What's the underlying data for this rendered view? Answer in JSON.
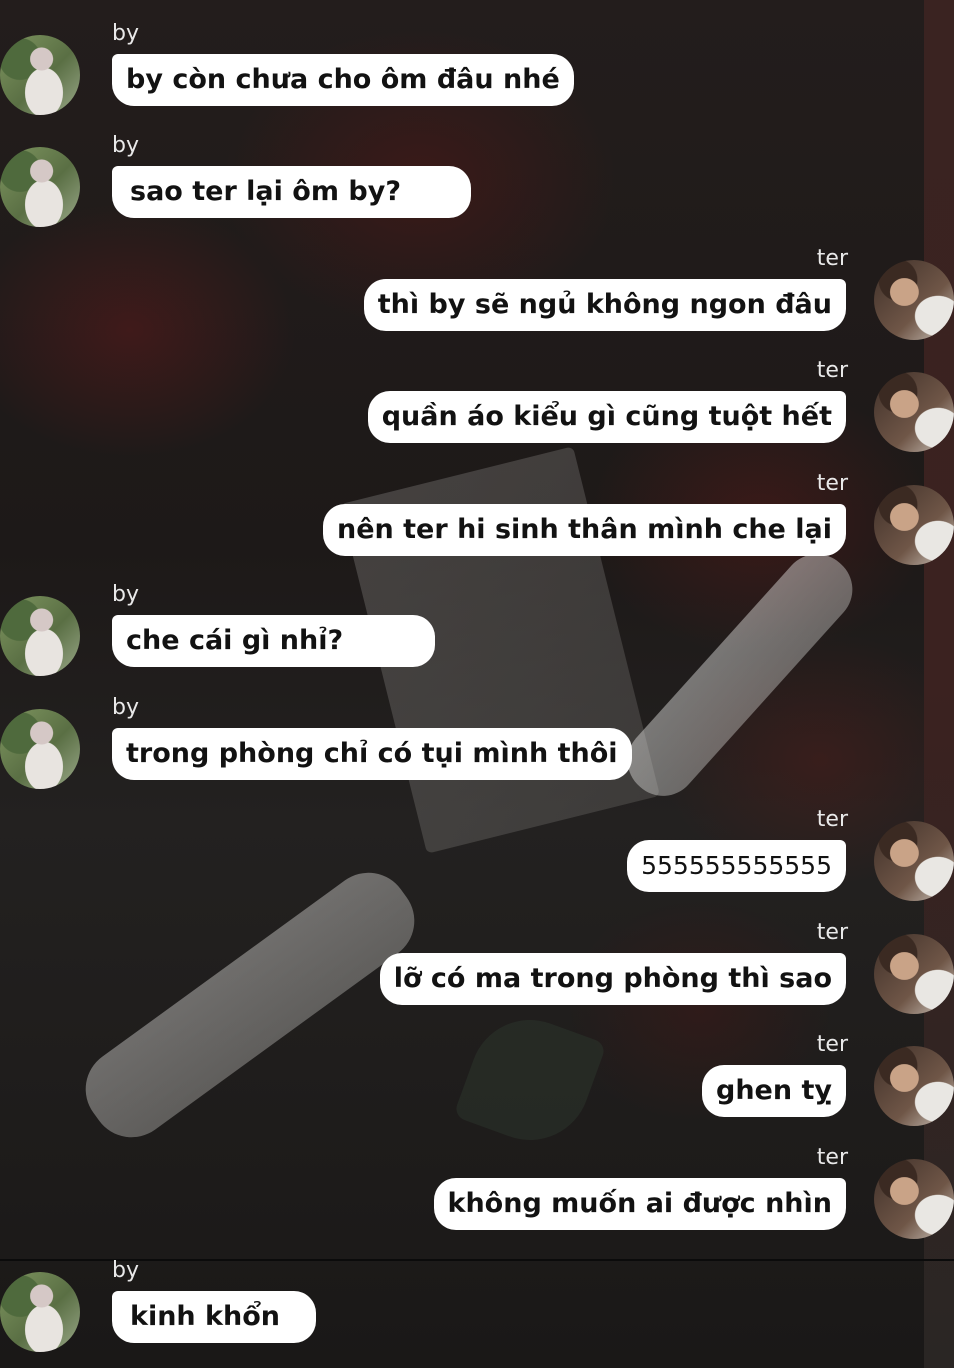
{
  "chat": {
    "messages": [
      {
        "sender": "by",
        "side": "left",
        "text": "by còn chưa cho ôm đâu nhé"
      },
      {
        "sender": "by",
        "side": "left",
        "text": "sao ter lại ôm by?"
      },
      {
        "sender": "ter",
        "side": "right",
        "text": "thì by sẽ ngủ không ngon đâu"
      },
      {
        "sender": "ter",
        "side": "right",
        "text": "quần áo kiểu gì cũng tuột hết"
      },
      {
        "sender": "ter",
        "side": "right",
        "text": "nên ter hi sinh thân mình che lại"
      },
      {
        "sender": "by",
        "side": "left",
        "text": "che cái gì nhỉ?"
      },
      {
        "sender": "by",
        "side": "left",
        "text": "trong phòng chỉ có tụi mình thôi"
      },
      {
        "sender": "ter",
        "side": "right",
        "text": "555555555555"
      },
      {
        "sender": "ter",
        "side": "right",
        "text": "lỡ có ma trong phòng thì sao"
      },
      {
        "sender": "ter",
        "side": "right",
        "text": "ghen tỵ"
      },
      {
        "sender": "ter",
        "side": "right",
        "text": "không muốn ai được nhìn"
      },
      {
        "sender": "by",
        "side": "left",
        "text": "kinh khổn"
      }
    ]
  },
  "colors": {
    "bubble_bg": "#ffffff",
    "bubble_text": "#121212",
    "name_text": "#e9e9e9",
    "background": "#191716"
  }
}
